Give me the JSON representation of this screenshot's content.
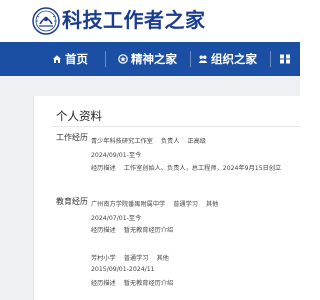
{
  "header": {
    "site_title": "科技工作者之家"
  },
  "nav": {
    "items": [
      {
        "label": "首页",
        "icon": "home-icon"
      },
      {
        "label": "精神之家",
        "icon": "spirit-icon"
      },
      {
        "label": "组织之家",
        "icon": "organization-icon"
      },
      {
        "label": "",
        "icon": "grid-icon"
      }
    ]
  },
  "profile": {
    "title": "个人资料",
    "work": {
      "label": "工作经历",
      "entry": {
        "org": "青少年科技研究工作室",
        "role": "负责人",
        "title": "正高级",
        "period": "2024/09/01-至今",
        "desc_label": "经历描述",
        "desc": "工作室创始人、负责人，总工程师，2024年9月15日创立"
      }
    },
    "education": {
      "label": "教育经历",
      "entries": [
        {
          "school": "广州南方学院番禺附属中学",
          "type": "普通学习",
          "other": "其他",
          "period": "2024/07/01-至今",
          "desc_label": "经历描述",
          "desc": "暂无教育经历介绍"
        },
        {
          "school": "芳村小学",
          "type": "普通学习",
          "other": "其他",
          "period": "2015/09/01-2024/11",
          "desc_label": "经历描述",
          "desc": "暂无教育经历介绍"
        }
      ]
    }
  },
  "colors": {
    "nav_bg": "#1b4fa3",
    "title": "#1a3d8f",
    "page_bg": "#eef0f3"
  }
}
